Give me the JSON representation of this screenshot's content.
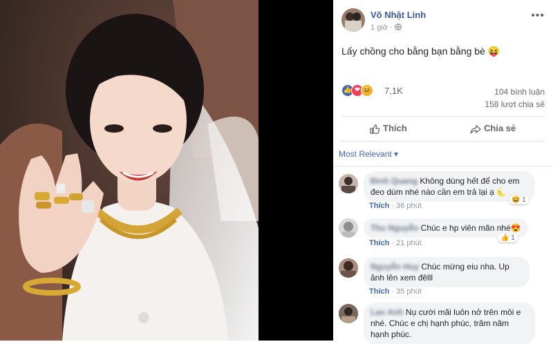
{
  "post": {
    "author": "Võ Nhật Linh",
    "time": "1 giờ",
    "text": "Lấy chồng cho bằng bạn bằng bè 😝",
    "reaction_count": "7,1K",
    "comments_count": "104 bình luận",
    "shares_count": "158 lượt chia sẻ",
    "like_label": "Thích",
    "share_label": "Chia sẻ",
    "sort_label": "Most Relevant ▾"
  },
  "comments": [
    {
      "name": "Đinh Quang",
      "text": "Không dùng hết để cho em đeo dùm nhé nào cần em trả lại ạ 🌜",
      "like": "Thích",
      "time": "36 phút",
      "reactions": "1"
    },
    {
      "name": "Thu Nguyễn",
      "text": "Chúc e hp viên mãn nhé😍",
      "like": "Thích",
      "time": "21 phút",
      "reactions": "1"
    },
    {
      "name": "Nguyễn Huy",
      "text": "Chúc mừng eiu nha. Up ảnh lên xem đêlll",
      "like": "Thích",
      "time": "35 phút",
      "reactions": ""
    },
    {
      "name": "Lan Anh",
      "text": "Nụ cười mãi luôn nở trên môi e nhé. Chúc e chị hạnh phúc, trăm năm hạnh phúc.",
      "like": "",
      "time": "",
      "reactions": ""
    }
  ],
  "colors": {
    "link": "#385898",
    "accent": "#4267b2",
    "bubble": "#f2f3f5",
    "muted": "#90949c"
  },
  "icons": [
    "more-options-icon",
    "globe-icon",
    "like-reaction-icon",
    "love-reaction-icon",
    "haha-reaction-icon",
    "thumbs-up-icon",
    "share-arrow-icon"
  ]
}
